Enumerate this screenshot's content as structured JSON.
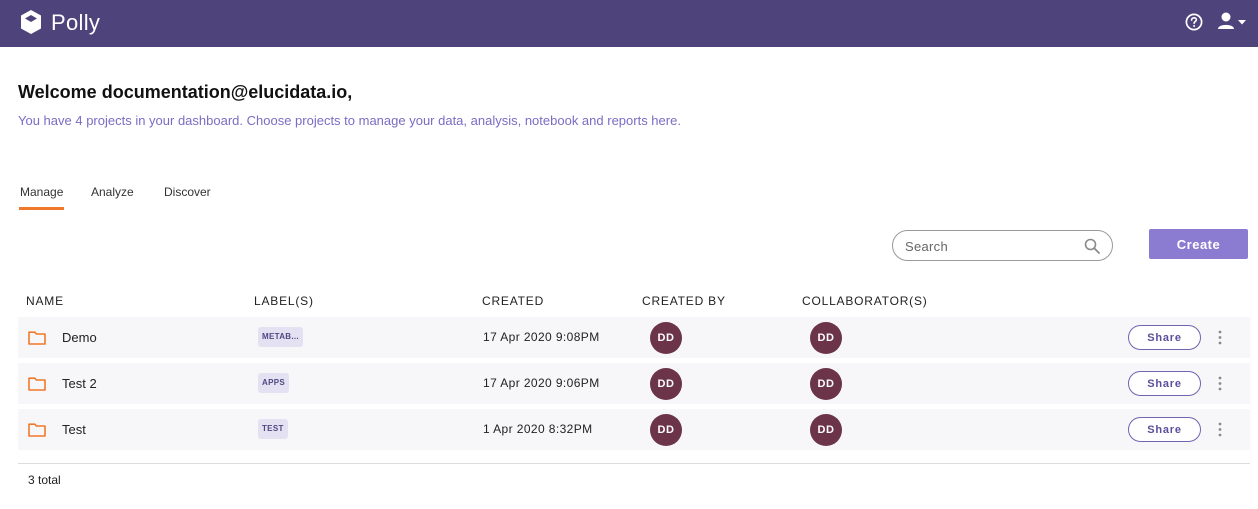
{
  "header": {
    "brand": "Polly",
    "colors": {
      "bar": "#4f437c",
      "accent": "#8b7cd1",
      "tab_indicator": "#f0782a",
      "avatar": "#6b3449",
      "folder": "#f0782a"
    },
    "icons": {
      "logo": "polly-logo-icon",
      "help": "help-icon",
      "user": "user-icon",
      "caret": "caret-down-icon"
    }
  },
  "welcome": {
    "title": "Welcome documentation@elucidata.io,",
    "subtitle": "You have 4 projects in your dashboard. Choose projects to manage your data, analysis, notebook and reports here."
  },
  "tabs": [
    {
      "label": "Manage",
      "active": true
    },
    {
      "label": "Analyze",
      "active": false
    },
    {
      "label": "Discover",
      "active": false
    }
  ],
  "toolbar": {
    "search_placeholder": "Search",
    "create_label": "Create"
  },
  "table": {
    "columns": [
      "NAME",
      "LABEL(S)",
      "CREATED",
      "CREATED BY",
      "COLLABORATOR(S)"
    ],
    "rows": [
      {
        "name": "Demo",
        "label": "METAB...",
        "created": "17 Apr 2020 9:08PM",
        "created_by": "DD",
        "collaborator": "DD",
        "share": "Share"
      },
      {
        "name": "Test 2",
        "label": "APPS",
        "created": "17 Apr 2020 9:06PM",
        "created_by": "DD",
        "collaborator": "DD",
        "share": "Share"
      },
      {
        "name": "Test",
        "label": "TEST",
        "created": "1 Apr 2020 8:32PM",
        "created_by": "DD",
        "collaborator": "DD",
        "share": "Share"
      }
    ],
    "total": "3 total"
  }
}
